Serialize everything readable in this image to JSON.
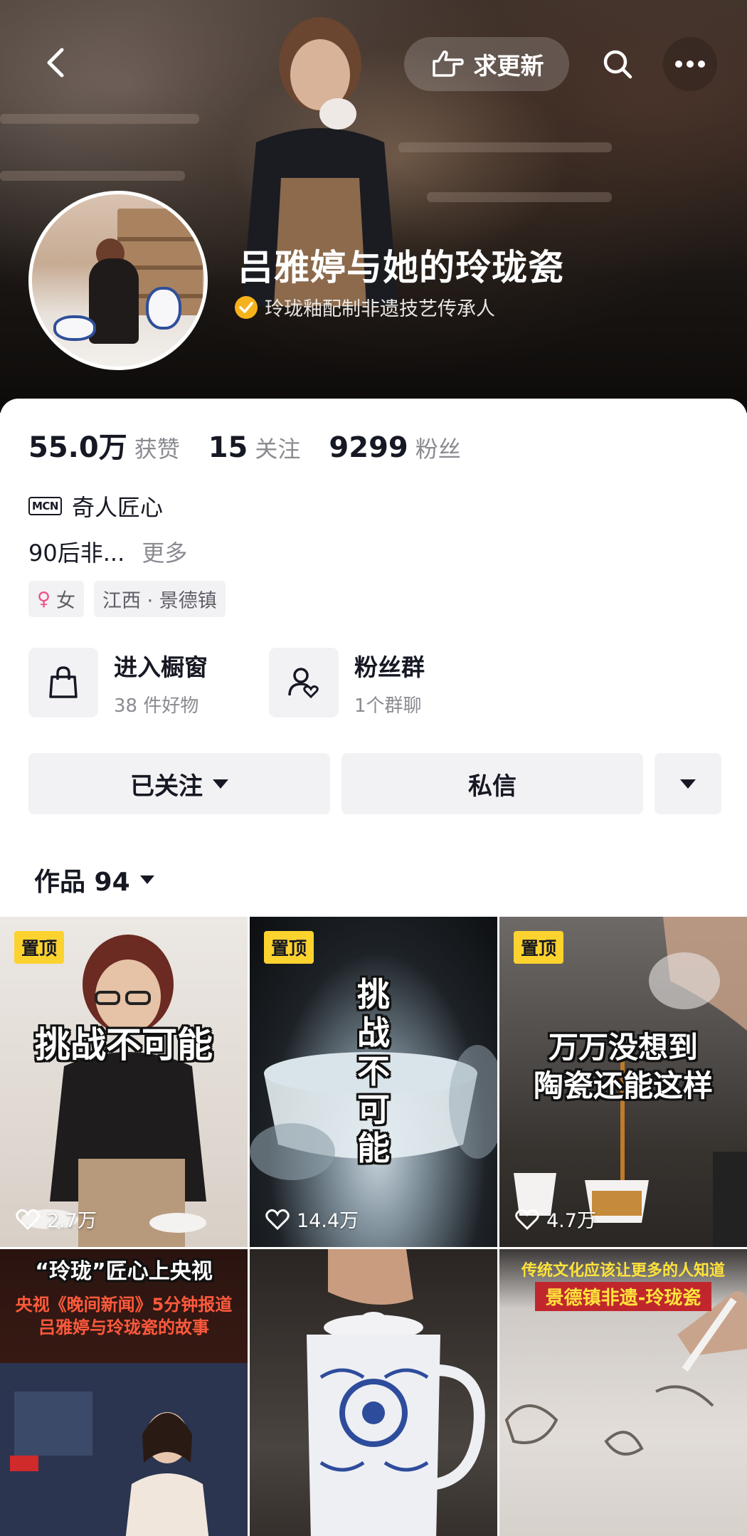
{
  "header": {
    "update_button_label": "求更新",
    "profile_name": "吕雅婷与她的玲珑瓷",
    "verification_text": "玲珑釉配制非遗技艺传承人"
  },
  "stats": {
    "likes_count": "55.0万",
    "likes_label": "获赞",
    "following_count": "15",
    "following_label": "关注",
    "followers_count": "9299",
    "followers_label": "粉丝"
  },
  "mcn": {
    "icon_text": "MCN",
    "name": "奇人匠心"
  },
  "bio": {
    "text": "90后非...",
    "more_label": "更多"
  },
  "tags": {
    "gender": "女",
    "location": "江西 · 景德镇"
  },
  "entries": [
    {
      "title": "进入橱窗",
      "subtitle": "38 件好物"
    },
    {
      "title": "粉丝群",
      "subtitle": "1个群聊"
    }
  ],
  "actions": {
    "follow_label": "已关注",
    "message_label": "私信"
  },
  "works": {
    "label": "作品 94"
  },
  "videos": [
    {
      "pinned": "置顶",
      "caption": "挑战不可能",
      "likes": "2.7万"
    },
    {
      "pinned": "置顶",
      "caption": "挑战不可能",
      "likes": "14.4万"
    },
    {
      "pinned": "置顶",
      "caption_line1": "万万没想到",
      "caption_line2": "陶瓷还能这样",
      "likes": "4.7万"
    },
    {
      "caption_line1": "“玲珑”匠心上央视",
      "caption_line2": "央视《晚间新闻》5分钟报道",
      "caption_line3": "吕雅婷与玲珑瓷的故事"
    },
    {},
    {
      "caption_line1": "传统文化应该让更多的人知道",
      "caption_line2": "景德镇非遗-玲珑瓷"
    }
  ],
  "colors": {
    "pin_yellow": "#fcd22f",
    "verify_orange": "#f6b21b",
    "text_primary": "#161823",
    "text_secondary": "#8a8b91"
  }
}
